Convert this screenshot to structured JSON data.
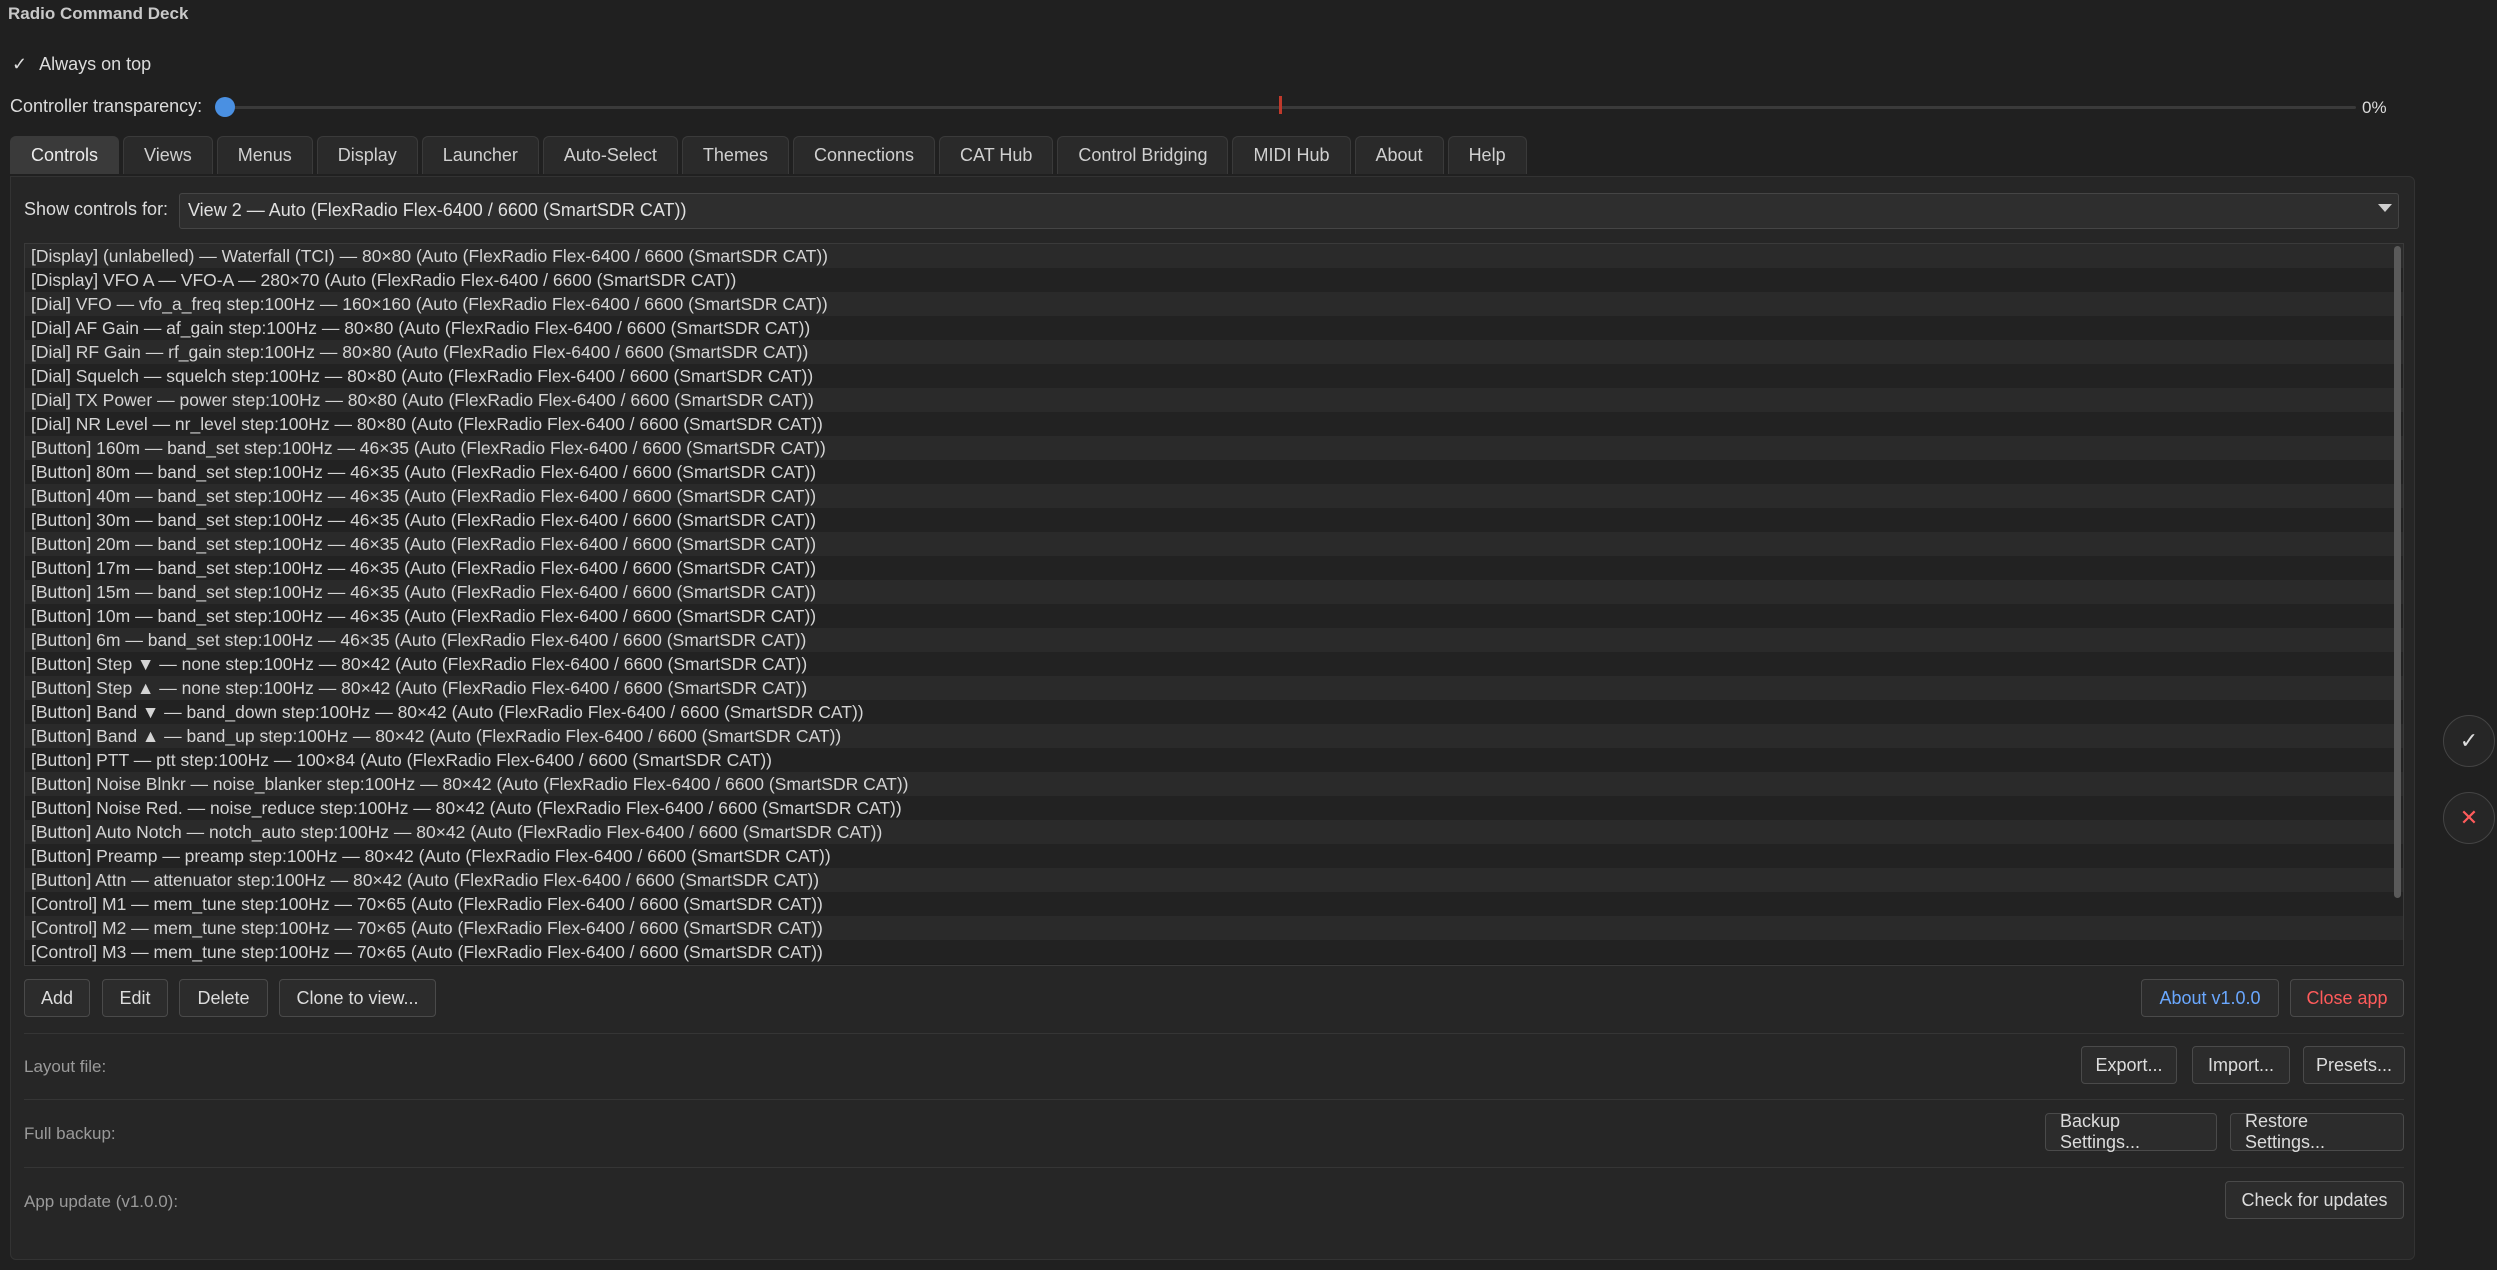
{
  "window": {
    "title": "Radio Command Deck"
  },
  "always_on_top": {
    "check": "✓",
    "label": "Always on top"
  },
  "transparency": {
    "label": "Controller transparency:",
    "value": "0%",
    "level": 0
  },
  "tabs": [
    {
      "label": "Controls"
    },
    {
      "label": "Views"
    },
    {
      "label": "Menus"
    },
    {
      "label": "Display"
    },
    {
      "label": "Launcher"
    },
    {
      "label": "Auto-Select"
    },
    {
      "label": "Themes"
    },
    {
      "label": "Connections"
    },
    {
      "label": "CAT Hub"
    },
    {
      "label": "Control Bridging"
    },
    {
      "label": "MIDI Hub"
    },
    {
      "label": "About"
    },
    {
      "label": "Help"
    }
  ],
  "controls": {
    "show_for_label": "Show controls for:",
    "show_for_value": "View 2 — Auto (FlexRadio Flex-6400 / 6600 (SmartSDR CAT))",
    "items": [
      "[Display] (unlabelled) — Waterfall (TCI) — 80×80  (Auto (FlexRadio Flex-6400 / 6600 (SmartSDR CAT))",
      "[Display] VFO A — VFO-A — 280×70  (Auto (FlexRadio Flex-6400 / 6600 (SmartSDR CAT))",
      "[Dial] VFO — vfo_a_freq  step:100Hz — 160×160  (Auto (FlexRadio Flex-6400 / 6600 (SmartSDR CAT))",
      "[Dial] AF Gain — af_gain  step:100Hz — 80×80  (Auto (FlexRadio Flex-6400 / 6600 (SmartSDR CAT))",
      "[Dial] RF Gain — rf_gain  step:100Hz — 80×80  (Auto (FlexRadio Flex-6400 / 6600 (SmartSDR CAT))",
      "[Dial] Squelch — squelch  step:100Hz — 80×80  (Auto (FlexRadio Flex-6400 / 6600 (SmartSDR CAT))",
      "[Dial] TX Power — power  step:100Hz — 80×80  (Auto (FlexRadio Flex-6400 / 6600 (SmartSDR CAT))",
      "[Dial] NR Level — nr_level  step:100Hz — 80×80  (Auto (FlexRadio Flex-6400 / 6600 (SmartSDR CAT))",
      "[Button] 160m — band_set  step:100Hz — 46×35  (Auto (FlexRadio Flex-6400 / 6600 (SmartSDR CAT))",
      "[Button] 80m — band_set  step:100Hz — 46×35  (Auto (FlexRadio Flex-6400 / 6600 (SmartSDR CAT))",
      "[Button] 40m — band_set  step:100Hz — 46×35  (Auto (FlexRadio Flex-6400 / 6600 (SmartSDR CAT))",
      "[Button] 30m — band_set  step:100Hz — 46×35  (Auto (FlexRadio Flex-6400 / 6600 (SmartSDR CAT))",
      "[Button] 20m — band_set  step:100Hz — 46×35  (Auto (FlexRadio Flex-6400 / 6600 (SmartSDR CAT))",
      "[Button] 17m — band_set  step:100Hz — 46×35  (Auto (FlexRadio Flex-6400 / 6600 (SmartSDR CAT))",
      "[Button] 15m — band_set  step:100Hz — 46×35  (Auto (FlexRadio Flex-6400 / 6600 (SmartSDR CAT))",
      "[Button] 10m — band_set  step:100Hz — 46×35  (Auto (FlexRadio Flex-6400 / 6600 (SmartSDR CAT))",
      "[Button] 6m — band_set  step:100Hz — 46×35  (Auto (FlexRadio Flex-6400 / 6600 (SmartSDR CAT))",
      "[Button] Step ▼ — none  step:100Hz — 80×42  (Auto (FlexRadio Flex-6400 / 6600 (SmartSDR CAT))",
      "[Button] Step ▲ — none  step:100Hz — 80×42  (Auto (FlexRadio Flex-6400 / 6600 (SmartSDR CAT))",
      "[Button] Band ▼ — band_down  step:100Hz — 80×42  (Auto (FlexRadio Flex-6400 / 6600 (SmartSDR CAT))",
      "[Button] Band ▲ — band_up  step:100Hz — 80×42  (Auto (FlexRadio Flex-6400 / 6600 (SmartSDR CAT))",
      "[Button] PTT — ptt  step:100Hz — 100×84  (Auto (FlexRadio Flex-6400 / 6600 (SmartSDR CAT))",
      "[Button] Noise Blnkr — noise_blanker  step:100Hz — 80×42  (Auto (FlexRadio Flex-6400 / 6600 (SmartSDR CAT))",
      "[Button] Noise Red. — noise_reduce  step:100Hz — 80×42  (Auto (FlexRadio Flex-6400 / 6600 (SmartSDR CAT))",
      "[Button] Auto Notch — notch_auto  step:100Hz — 80×42  (Auto (FlexRadio Flex-6400 / 6600 (SmartSDR CAT))",
      "[Button] Preamp — preamp  step:100Hz — 80×42  (Auto (FlexRadio Flex-6400 / 6600 (SmartSDR CAT))",
      "[Button] Attn — attenuator  step:100Hz — 80×42  (Auto (FlexRadio Flex-6400 / 6600 (SmartSDR CAT))",
      "[Control] M1 — mem_tune  step:100Hz — 70×65  (Auto (FlexRadio Flex-6400 / 6600 (SmartSDR CAT))",
      "[Control] M2 — mem_tune  step:100Hz — 70×65  (Auto (FlexRadio Flex-6400 / 6600 (SmartSDR CAT))",
      "[Control] M3 — mem_tune  step:100Hz — 70×65  (Auto (FlexRadio Flex-6400 / 6600 (SmartSDR CAT))"
    ],
    "add": "Add",
    "edit": "Edit",
    "delete": "Delete",
    "clone": "Clone to view...",
    "about": "About  v1.0.0",
    "close": "Close app"
  },
  "layout_file": {
    "label": "Layout file:",
    "export": "Export...",
    "import": "Import...",
    "presets": "Presets..."
  },
  "full_backup": {
    "label": "Full backup:",
    "backup": "Backup Settings...",
    "restore": "Restore Settings..."
  },
  "app_update": {
    "label": "App update  (v1.0.0):",
    "check": "Check for updates"
  },
  "side": {
    "confirm": "✓",
    "cancel": "✕"
  },
  "colors": {
    "accent": "#4a90e2",
    "danger": "#ff5b5b",
    "link": "#6aa8ff"
  }
}
